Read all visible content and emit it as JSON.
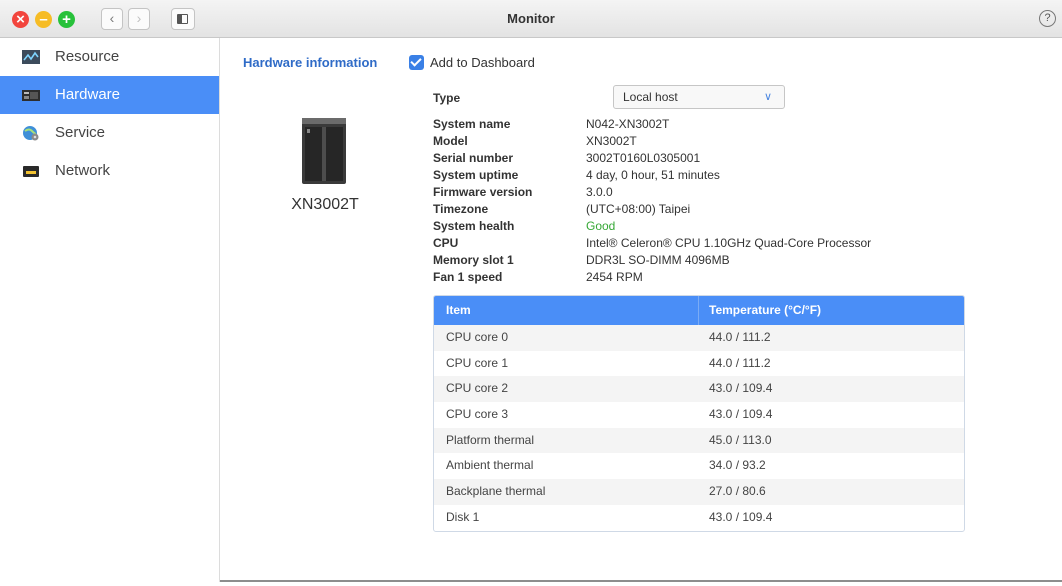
{
  "window": {
    "title": "Monitor"
  },
  "titlebar": {
    "help_glyph": "?"
  },
  "sidebar": {
    "items": [
      {
        "label": "Resource",
        "icon": "resource-chart-icon",
        "active": false
      },
      {
        "label": "Hardware",
        "icon": "hardware-icon",
        "active": true
      },
      {
        "label": "Service",
        "icon": "service-globe-icon",
        "active": false
      },
      {
        "label": "Network",
        "icon": "network-icon",
        "active": false
      }
    ]
  },
  "main": {
    "section_title": "Hardware information",
    "add_to_dashboard": {
      "label": "Add to Dashboard",
      "checked": true
    },
    "device_name": "XN3002T",
    "type": {
      "label": "Type",
      "selected": "Local host"
    },
    "info": [
      {
        "key": "System name",
        "value": "N042-XN3002T"
      },
      {
        "key": "Model",
        "value": "XN3002T"
      },
      {
        "key": "Serial number",
        "value": "3002T0160L0305001"
      },
      {
        "key": "System uptime",
        "value": "4 day, 0 hour, 51 minutes"
      },
      {
        "key": "Firmware version",
        "value": "3.0.0"
      },
      {
        "key": "Timezone",
        "value": "(UTC+08:00) Taipei"
      },
      {
        "key": "System health",
        "value": "Good"
      },
      {
        "key": "CPU",
        "value": "Intel® Celeron® CPU 1.10GHz Quad-Core Processor"
      },
      {
        "key": "Memory slot 1",
        "value": "DDR3L SO-DIMM 4096MB"
      },
      {
        "key": "Fan 1 speed",
        "value": "2454 RPM"
      }
    ],
    "temperature_table": {
      "headers": [
        "Item",
        "Temperature (°C/°F)"
      ],
      "rows": [
        [
          "CPU core 0",
          "44.0 / 111.2"
        ],
        [
          "CPU core 1",
          "44.0 / 111.2"
        ],
        [
          "CPU core 2",
          "43.0 / 109.4"
        ],
        [
          "CPU core 3",
          "43.0 / 109.4"
        ],
        [
          "Platform thermal",
          "45.0 / 113.0"
        ],
        [
          "Ambient thermal",
          "34.0 / 93.2"
        ],
        [
          "Backplane thermal",
          "27.0 / 80.6"
        ],
        [
          "Disk 1",
          "43.0 / 109.4"
        ]
      ]
    }
  },
  "colors": {
    "accent": "#4a8ef7",
    "link": "#2f6bc7",
    "good": "#36a836"
  }
}
